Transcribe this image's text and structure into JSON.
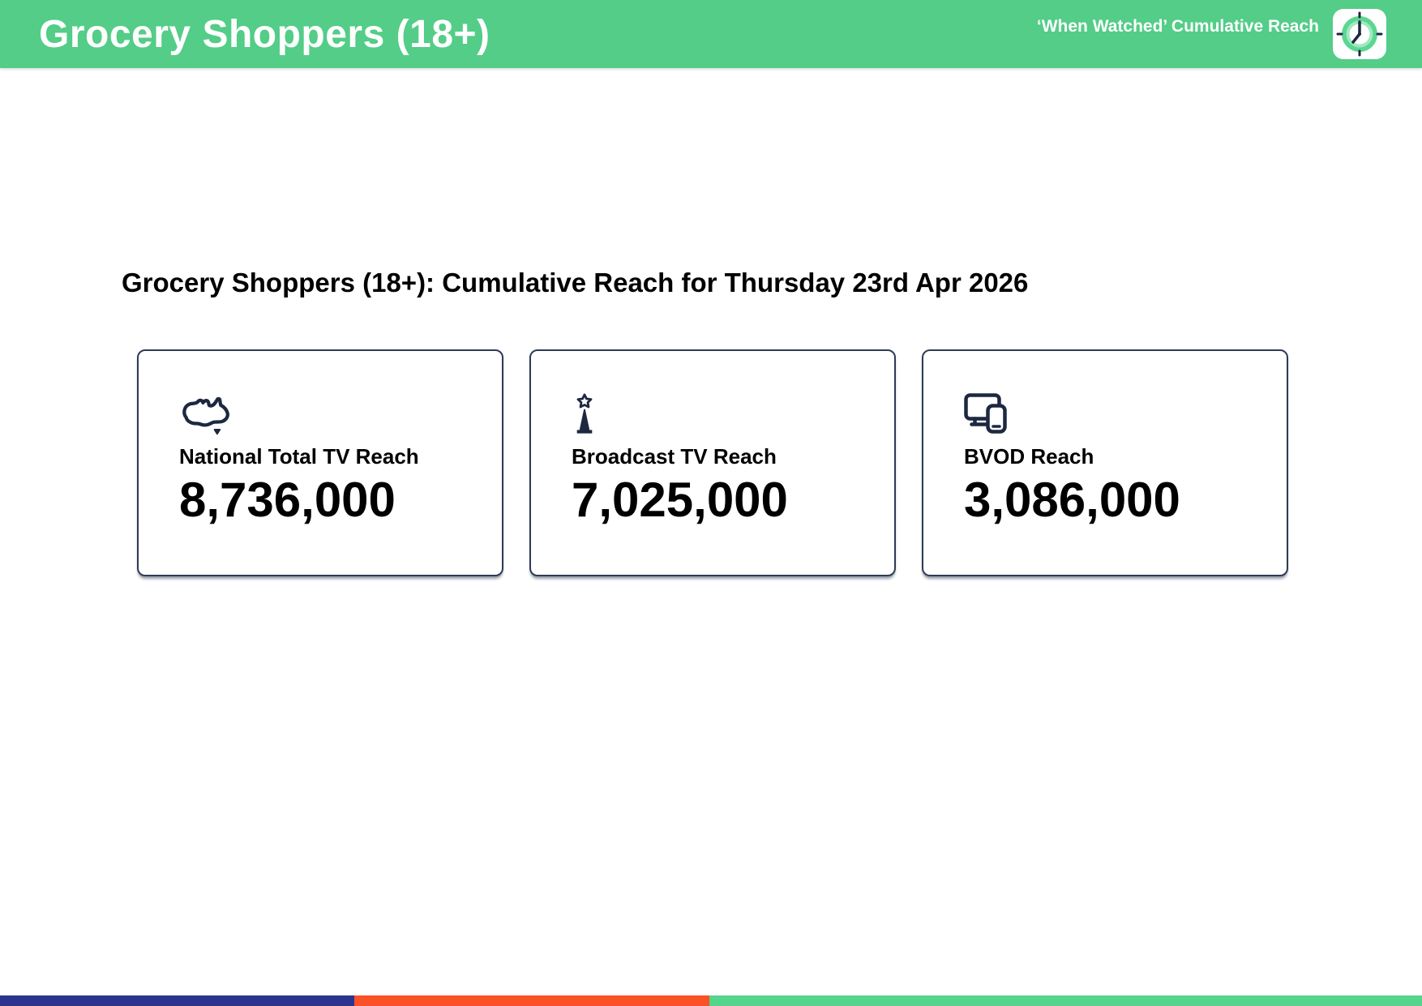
{
  "header": {
    "title": "Grocery Shoppers (18+)",
    "subtitle": "‘When Watched’ Cumulative Reach",
    "bg_color": "#53CD87",
    "clock_icon": "clock-logo-icon"
  },
  "main": {
    "heading": "Grocery Shoppers (18+): Cumulative Reach for Thursday 23rd Apr 2026",
    "cards": [
      {
        "icon": "australia-map-icon",
        "label": "National Total TV Reach",
        "value": "8,736,000"
      },
      {
        "icon": "broadcast-tower-icon",
        "label": "Broadcast TV Reach",
        "value": "7,025,000"
      },
      {
        "icon": "devices-icon",
        "label": "BVOD Reach",
        "value": "3,086,000"
      }
    ]
  },
  "footer": {
    "segments": [
      {
        "name": "navy",
        "color": "#2B3590"
      },
      {
        "name": "orange",
        "color": "#FA5126"
      },
      {
        "name": "green",
        "color": "#55D48C"
      }
    ]
  },
  "colors": {
    "icon_navy": "#1D2840",
    "card_border": "#2E3B55",
    "clock_green": "#5CD691",
    "clock_green_light": "#9FE9C0"
  }
}
